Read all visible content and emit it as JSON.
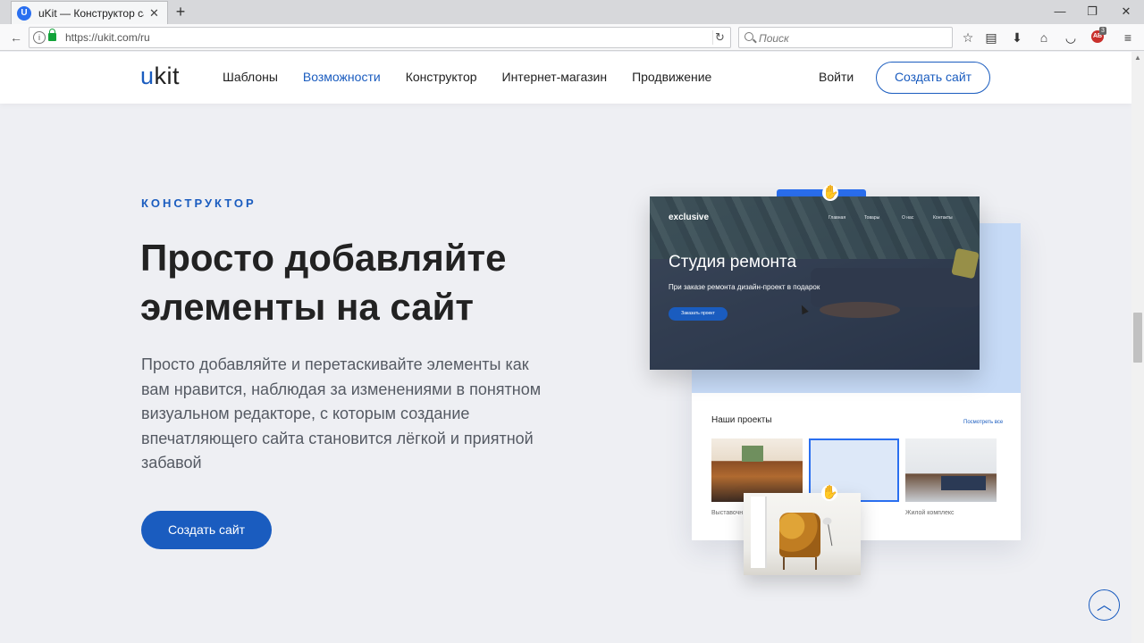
{
  "browser": {
    "tab_title": "uKit — Конструктор сайт...",
    "tab_favicon": "U",
    "new_tab_icon": "+",
    "url": "https://ukit.com/ru",
    "search_placeholder": "Поиск",
    "extension_badge": "3",
    "window_controls": {
      "minimize": "—",
      "restore": "❐",
      "close": "✕"
    },
    "icons": [
      "back-icon",
      "info-icon",
      "lock-icon",
      "reload-icon",
      "search-icon",
      "bookmark-star-icon",
      "library-icon",
      "download-icon",
      "home-icon",
      "pocket-icon",
      "adblock-icon",
      "menu-icon"
    ]
  },
  "header": {
    "logo_prefix": "u",
    "logo_rest": "kit",
    "nav": [
      {
        "label": "Шаблоны",
        "active": false
      },
      {
        "label": "Возможности",
        "active": true
      },
      {
        "label": "Конструктор",
        "active": false
      },
      {
        "label": "Интернет-магазин",
        "active": false
      },
      {
        "label": "Продвижение",
        "active": false
      }
    ],
    "login_label": "Войти",
    "cta_label": "Создать сайт"
  },
  "hero": {
    "eyebrow": "КОНСТРУКТОР",
    "title": "Просто добавляйте элементы на сайт",
    "description": "Просто добавляйте и перетаскивайте элементы как вам нравится, наблюдая за изменениями в понятном визуальном редакторе, с которым создание впечатляющего сайта становится лёгкой и приятной забавой",
    "cta_label": "Создать сайт"
  },
  "illustration": {
    "front_card": {
      "brand": "exclusive",
      "nav": [
        "Главная",
        "Товары",
        "О нас",
        "Контакты"
      ],
      "title": "Студия ремонта",
      "subtitle": "При заказе ремонта дизайн-проект в подарок",
      "button": "Заказать проект"
    },
    "back_card": {
      "projects_title": "Наши проекты",
      "see_all": "Посмотреть все",
      "captions": [
        "Выставочн",
        "Жилой комплекс"
      ]
    }
  },
  "scroll_top_icon": "︿",
  "colors": {
    "accent": "#1a5cbf",
    "page_bg": "#eeeff3",
    "card_blue": "#c6daf6"
  }
}
